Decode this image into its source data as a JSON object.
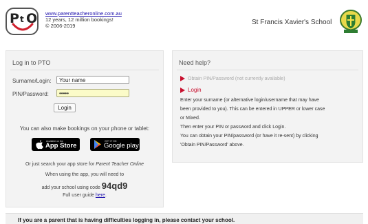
{
  "header": {
    "logo_text": "PTO",
    "website_link": "www.parentteacheronline.com.au",
    "tagline": "12 years, 12 million bookings!",
    "copyright": "© 2006-2019",
    "school_name": "St Francis Xavier's School"
  },
  "login": {
    "title": "Log in to PTO",
    "surname_label": "Surname/Login:",
    "surname_value": "Your name",
    "pin_label": "PIN/Password:",
    "pin_value": "•••••",
    "login_button": "Login",
    "mobile_text": "You can also make bookings on your phone or tablet:",
    "app_store_small": "Available on the",
    "app_store_big": "App Store",
    "google_play_small": "GET IT ON",
    "google_play_big": "Google play",
    "search_prefix": "Or just search your app store for ",
    "search_app_name": "Parent Teacher Online",
    "when_using": "When using the app, you will need to",
    "add_school_prefix": "add your school using code ",
    "school_code": "94qd9",
    "guide_prefix": "Full user guide ",
    "guide_link": "here",
    "guide_suffix": "."
  },
  "help": {
    "title": "Need help?",
    "obtain_pin_link": "Obtain PIN/Password (not currently available)",
    "login_link": "Login",
    "line1": "Enter your surname (or alternative login/username that may have",
    "line2": "been provided to you). This can be entered in UPPER or lower case",
    "line3": "or Mixed.",
    "line4": "Then enter your PIN or password and click Login.",
    "line5": "You can obtain your PIN/password (or have it re-sent) by clicking",
    "line6": "'Obtain PIN/Password' above."
  },
  "notice": {
    "text": "If you are a parent that is having difficulties logging in, please contact your school."
  },
  "colors": {
    "accent_red": "#c8102e",
    "link_blue": "#1a0dab",
    "pin_highlight": "#fbfbc8"
  }
}
